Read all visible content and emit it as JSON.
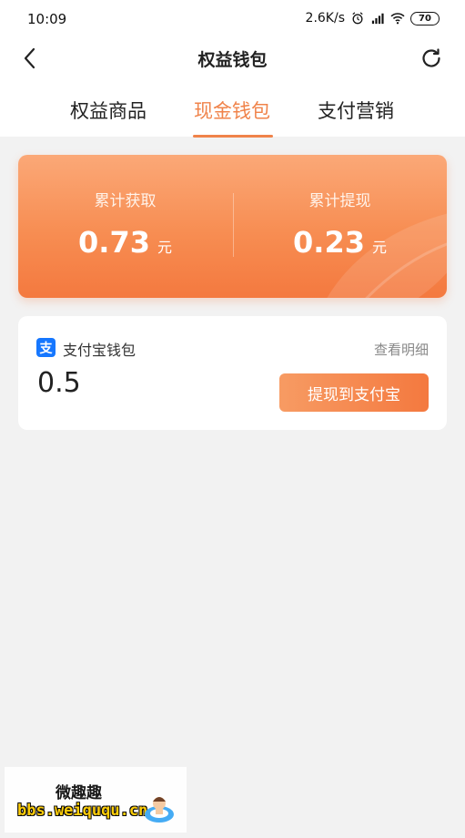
{
  "status_bar": {
    "time": "10:09",
    "network_speed": "2.6K/s",
    "battery": "70"
  },
  "header": {
    "title": "权益钱包"
  },
  "tabs": [
    {
      "label": "权益商品",
      "active": false
    },
    {
      "label": "现金钱包",
      "active": true
    },
    {
      "label": "支付营销",
      "active": false
    }
  ],
  "summary": {
    "total_earned_label": "累计获取",
    "total_earned_value": "0.73",
    "total_withdrawn_label": "累计提现",
    "total_withdrawn_value": "0.23",
    "unit": "元"
  },
  "wallet": {
    "logo_char": "支",
    "name": "支付宝钱包",
    "detail_link": "查看明细",
    "balance": "0.5",
    "withdraw_button": "提现到支付宝"
  },
  "watermark": {
    "title": "微趣趣",
    "url": "bbs.weiququ.cn"
  },
  "colors": {
    "accent": "#f0834a",
    "summary_gradient_top": "#fba877",
    "summary_gradient_bottom": "#f4793f",
    "alipay_blue": "#1677ff",
    "page_background": "#f2f2f2"
  }
}
